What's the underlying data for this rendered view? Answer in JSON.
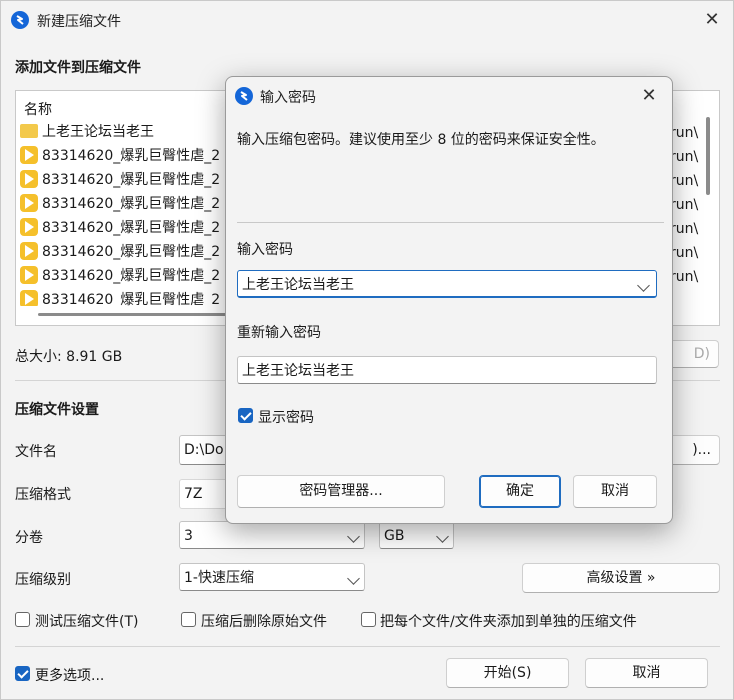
{
  "window": {
    "title": "新建压缩文件",
    "close_glyph": "✕"
  },
  "add_section": {
    "title": "添加文件到压缩文件"
  },
  "file_list": {
    "header": "名称",
    "rows": [
      {
        "type": "folder",
        "name": "上老王论坛当老王"
      },
      {
        "type": "video",
        "name": "83314620_爆乳巨臀性虐_2"
      },
      {
        "type": "video",
        "name": "83314620_爆乳巨臀性虐_2"
      },
      {
        "type": "video",
        "name": "83314620_爆乳巨臀性虐_2"
      },
      {
        "type": "video",
        "name": "83314620_爆乳巨臀性虐_2"
      },
      {
        "type": "video",
        "name": "83314620_爆乳巨臀性虐_2"
      },
      {
        "type": "video",
        "name": "83314620_爆乳巨臀性虐_2"
      },
      {
        "type": "video",
        "name": "83314620_爆乳巨臀性虐_2"
      }
    ],
    "right_col": [
      "run\\",
      "run\\",
      "run\\",
      "run\\",
      "run\\",
      "run\\",
      "run\\"
    ]
  },
  "total_size": "总大小: 8.91 GB",
  "settings": {
    "title": "压缩文件设置",
    "filename_label": "文件名",
    "filename_value": "D:\\Do",
    "browse_label": ")...",
    "format_label": "压缩格式",
    "format_value": "7Z",
    "split_label": "分卷",
    "split_value": "3",
    "split_unit": "GB",
    "level_label": "压缩级别",
    "level_value": "1-快速压缩",
    "advanced_button": "高级设置 »",
    "opt_test": "测试压缩文件(T)",
    "opt_delete": "压缩后删除原始文件",
    "opt_each": "把每个文件/文件夹添加到单独的压缩文件",
    "hidden_btn": "D)"
  },
  "footer": {
    "more_options": "更多选项...",
    "start_button": "开始(S)",
    "cancel_button": "取消"
  },
  "dialog": {
    "title": "输入密码",
    "close_glyph": "✕",
    "description": "输入压缩包密码。建议使用至少 8 位的密码来保证安全性。",
    "password_label": "输入密码",
    "password_value": "上老王论坛当老王",
    "reenter_label": "重新输入密码",
    "reenter_value": "上老王论坛当老王",
    "show_password": "显示密码",
    "manager_button": "密码管理器...",
    "ok_button": "确定",
    "cancel_button": "取消"
  }
}
